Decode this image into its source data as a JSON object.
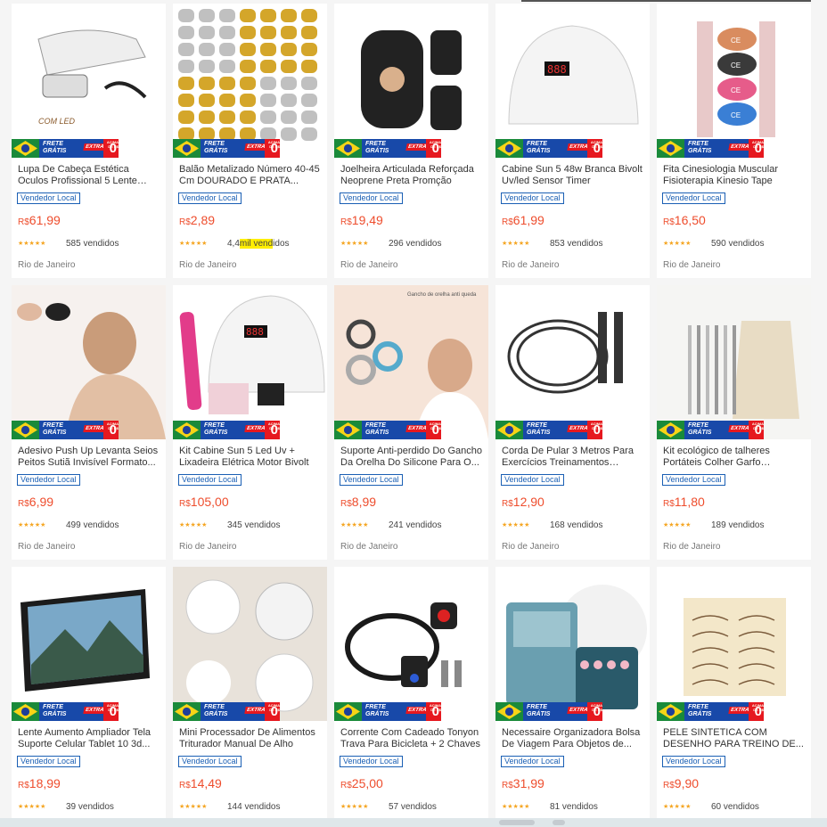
{
  "badge": {
    "frete_line1": "FRETE",
    "frete_line2": "GRÁTIS",
    "extra": "EXTRA",
    "acima": "ACIMA DE R$",
    "zero": "0"
  },
  "vendor_label": "Vendedor Local",
  "location": "Rio de Janeiro",
  "rating_stars": "★★★★★",
  "products": [
    {
      "title": "Lupa De Cabeça Estética Oculos Profissional 5 Lente Aumento",
      "currency": "R$",
      "price": "61,99",
      "sold": "585 vendidos",
      "img_text": "COM LED",
      "icon": "magnifier-glasses-icon"
    },
    {
      "title": "Balão Metalizado Número 40-45 Cm DOURADO E PRATA...",
      "currency": "R$",
      "price": "2,89",
      "sold_pre": "4,4",
      "sold_hl": "mil vend",
      "sold_post": "idos",
      "img_text": "",
      "icon": "balloon-letters-icon"
    },
    {
      "title": "Joelheira Articulada Reforçada Neoprene Preta Promção",
      "currency": "R$",
      "price": "19,49",
      "sold": "296 vendidos",
      "img_text": "",
      "icon": "knee-brace-icon"
    },
    {
      "title": "Cabine Sun 5 48w Branca Bivolt Uv/led Sensor Timer",
      "currency": "R$",
      "price": "61,99",
      "sold": "853 vendidos",
      "img_text": "888",
      "icon": "uv-lamp-icon"
    },
    {
      "title": "Fita Cinesiologia Muscular Fisioterapia Kinesio Tape",
      "currency": "R$",
      "price": "16,50",
      "sold": "590 vendidos",
      "img_text": "CE",
      "icon": "tape-rolls-icon"
    },
    {
      "title": "Adesivo Push Up Levanta Seios Peitos Sutiã Invisível Formato...",
      "currency": "R$",
      "price": "6,99",
      "sold": "499 vendidos",
      "img_text": "",
      "icon": "adhesive-bra-icon"
    },
    {
      "title": "Kit Cabine Sun 5 Led Uv + Lixadeira Elétrica Motor Bivolt",
      "currency": "R$",
      "price": "105,00",
      "sold": "345 vendidos",
      "img_text": "888",
      "icon": "nail-kit-icon"
    },
    {
      "title": "Suporte Anti-perdido Do Gancho Da Orelha Do Silicone Para O...",
      "currency": "R$",
      "price": "8,99",
      "sold": "241 vendidos",
      "img_text": "Gancho de orelha anti queda",
      "icon": "ear-hook-icon"
    },
    {
      "title": "Corda De Pular 3 Metros Para Exercícios Treinamentos Cross...",
      "currency": "R$",
      "price": "12,90",
      "sold": "168 vendidos",
      "img_text": "",
      "icon": "jump-rope-icon"
    },
    {
      "title": "Kit ecológico de talheres Portáteis Colher Garfo Canudo...",
      "currency": "R$",
      "price": "11,80",
      "sold": "189 vendidos",
      "img_text": "",
      "icon": "cutlery-kit-icon"
    },
    {
      "title": "Lente Aumento Ampliador Tela Suporte Celular Tablet 10 3d...",
      "currency": "R$",
      "price": "18,99",
      "sold": "39 vendidos",
      "img_text": "",
      "icon": "screen-magnifier-icon"
    },
    {
      "title": "Mini Processador De Alimentos Triturador Manual De Alho",
      "currency": "R$",
      "price": "14,49",
      "sold": "144 vendidos",
      "img_text": "",
      "icon": "garlic-chopper-icon"
    },
    {
      "title": "Corrente Com Cadeado Tonyon Trava Para Bicicleta + 2 Chaves",
      "currency": "R$",
      "price": "25,00",
      "sold": "57 vendidos",
      "img_text": "",
      "icon": "bike-lock-icon"
    },
    {
      "title": "Necessaire Organizadora Bolsa De Viagem Para Objetos de...",
      "currency": "R$",
      "price": "31,99",
      "sold": "81 vendidos",
      "img_text": "",
      "icon": "travel-bag-icon"
    },
    {
      "title": "PELE SINTETICA COM DESENHO PARA TREINO DE...",
      "currency": "R$",
      "price": "9,90",
      "sold": "60 vendidos",
      "img_text": "",
      "icon": "synthetic-skin-icon"
    }
  ]
}
